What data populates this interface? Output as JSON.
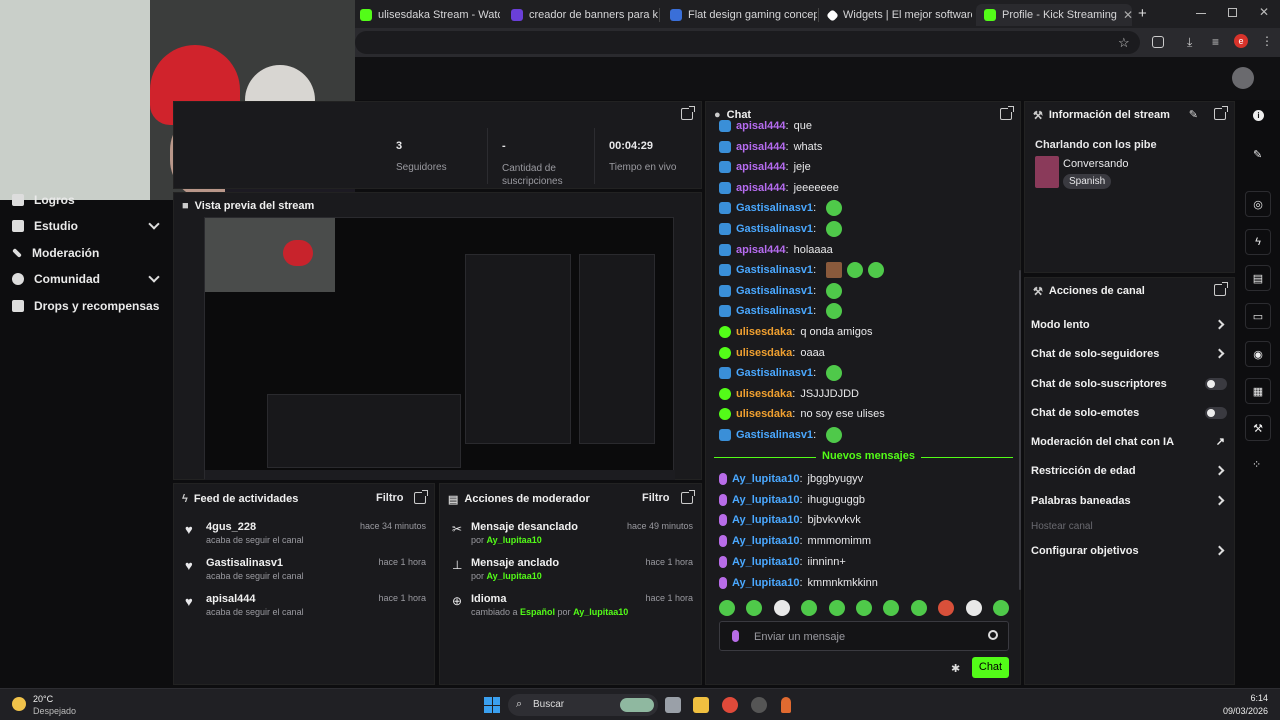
{
  "browser": {
    "tabs": [
      {
        "label": "ulisesdaka Stream - Watch Live",
        "icon_color": "#53fc18"
      },
      {
        "label": "creador de banners para kick",
        "icon_color": "#6a3fd8"
      },
      {
        "label": "Flat design gaming concept tw",
        "icon_color": "#3a6fd8"
      },
      {
        "label": "Widgets | El mejor software pa",
        "icon_color": "#ffffff"
      },
      {
        "label": "Profile - Kick Streaming",
        "icon_color": "#53fc18"
      }
    ],
    "new_tab": "+",
    "profile_initial": "e"
  },
  "sidebar": {
    "items": [
      {
        "label": "Logros"
      },
      {
        "label": "Estudio"
      },
      {
        "label": "Moderación"
      },
      {
        "label": "Comunidad"
      },
      {
        "label": "Drops y recompensas"
      }
    ]
  },
  "stats": [
    {
      "value": "3",
      "label": "Seguidores"
    },
    {
      "value": "-",
      "label": "Cantidad de suscripciones"
    },
    {
      "value": "00:04:29",
      "label": "Tiempo en vivo"
    }
  ],
  "preview": {
    "title": "Vista previa del stream"
  },
  "chat": {
    "title": "Chat",
    "messages": [
      {
        "user": "apisal444",
        "text": "que",
        "color": "purple",
        "badge": "blue"
      },
      {
        "user": "apisal444",
        "text": "whats",
        "color": "purple",
        "badge": "blue"
      },
      {
        "user": "apisal444",
        "text": "jeje",
        "color": "purple",
        "badge": "blue"
      },
      {
        "user": "apisal444",
        "text": "jeeeeeee",
        "color": "purple",
        "badge": "blue"
      },
      {
        "user": "Gastisalinasv1",
        "text": "",
        "color": "blue",
        "badge": "blue",
        "emotes": 1
      },
      {
        "user": "Gastisalinasv1",
        "text": "",
        "color": "blue",
        "badge": "blue",
        "emotes": 1
      },
      {
        "user": "apisal444",
        "text": "holaaaa",
        "color": "purple",
        "badge": "blue"
      },
      {
        "user": "Gastisalinasv1",
        "text": "",
        "color": "blue",
        "badge": "blue",
        "emotes": 3
      },
      {
        "user": "Gastisalinasv1",
        "text": "",
        "color": "blue",
        "badge": "blue",
        "emotes": 1
      },
      {
        "user": "Gastisalinasv1",
        "text": "",
        "color": "blue",
        "badge": "blue",
        "emotes": 1
      },
      {
        "user": "ulisesdaka",
        "text": "q onda amigos",
        "color": "orange",
        "badge": "green"
      },
      {
        "user": "ulisesdaka",
        "text": "oaaa",
        "color": "orange",
        "badge": "green"
      },
      {
        "user": "Gastisalinasv1",
        "text": "",
        "color": "blue",
        "badge": "blue",
        "emotes": 1
      },
      {
        "user": "ulisesdaka",
        "text": "JSJJJDJDD",
        "color": "orange",
        "badge": "green"
      },
      {
        "user": "ulisesdaka",
        "text": "no soy ese ulises",
        "color": "orange",
        "badge": "green"
      },
      {
        "user": "Gastisalinasv1",
        "text": "",
        "color": "blue",
        "badge": "blue",
        "emotes": 1
      }
    ],
    "new_messages_label": "Nuevos mensajes",
    "new_messages": [
      {
        "user": "Ay_lupitaa10",
        "text": "jbggbyugyv"
      },
      {
        "user": "Ay_lupitaa10",
        "text": "ihuguguggb"
      },
      {
        "user": "Ay_lupitaa10",
        "text": "bjbvkvvkvk"
      },
      {
        "user": "Ay_lupitaa10",
        "text": "mmmomimm"
      },
      {
        "user": "Ay_lupitaa10",
        "text": "iinninn+"
      },
      {
        "user": "Ay_lupitaa10",
        "text": "kmmnkmkkinn"
      }
    ],
    "input_placeholder": "Enviar un mensaje",
    "send_label": "Chat",
    "emote_count": 11
  },
  "stream_info": {
    "title": "Información del stream",
    "stream_title": "Charlando con los pibe",
    "category": "Conversando",
    "language": "Spanish"
  },
  "channel_actions": {
    "title": "Acciones de canal",
    "items": [
      {
        "label": "Modo lento",
        "control": "arrow"
      },
      {
        "label": "Chat de solo-seguidores",
        "control": "arrow"
      },
      {
        "label": "Chat de solo-suscriptores",
        "control": "toggle"
      },
      {
        "label": "Chat de solo-emotes",
        "control": "toggle"
      },
      {
        "label": "Moderación del chat con IA",
        "control": "external"
      },
      {
        "label": "Restricción de edad",
        "control": "arrow"
      },
      {
        "label": "Palabras baneadas",
        "control": "arrow"
      },
      {
        "label": "Hostear canal",
        "control": "disabled"
      },
      {
        "label": "Configurar objetivos",
        "control": "arrow"
      }
    ]
  },
  "feed": {
    "title": "Feed de actividades",
    "filter": "Filtro",
    "items": [
      {
        "user": "4gus_228",
        "desc": "acaba de seguir el canal",
        "time": "hace 34 minutos"
      },
      {
        "user": "Gastisalinasv1",
        "desc": "acaba de seguir el canal",
        "time": "hace 1 hora"
      },
      {
        "user": "apisal444",
        "desc": "acaba de seguir el canal",
        "time": "hace 1 hora"
      }
    ]
  },
  "modactions": {
    "title": "Acciones de moderador",
    "filter": "Filtro",
    "items": [
      {
        "title": "Mensaje desanclado",
        "pre": "por ",
        "actor": "Ay_lupitaa10",
        "time": "hace 49 minutos"
      },
      {
        "title": "Mensaje anclado",
        "pre": "por ",
        "actor": "Ay_lupitaa10",
        "time": "hace 1 hora"
      },
      {
        "title": "Idioma",
        "pre": "cambiado a ",
        "mid": "Español",
        "mid2": " por ",
        "actor": "Ay_lupitaa10",
        "time": "hace 1 hora"
      }
    ]
  },
  "taskbar": {
    "weather_temp": "20°C",
    "weather_desc": "Despejado",
    "search": "Buscar",
    "time": "6:14",
    "date": "09/03/2026"
  },
  "colors": {
    "accent": "#53fc18",
    "panel": "#1a1a1d"
  }
}
